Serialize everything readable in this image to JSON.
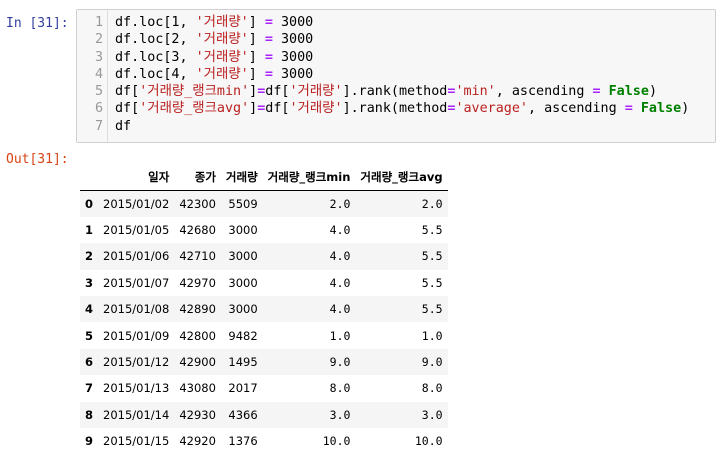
{
  "input_prompt": "In [31]:",
  "output_prompt": "Out[31]:",
  "code": [
    {
      "num": "1",
      "segments": [
        {
          "t": "df.loc[1, ",
          "c": ""
        },
        {
          "t": "'거래량'",
          "c": "t-str"
        },
        {
          "t": "] ",
          "c": ""
        },
        {
          "t": "=",
          "c": "t-op"
        },
        {
          "t": " 3000",
          "c": ""
        }
      ]
    },
    {
      "num": "2",
      "segments": [
        {
          "t": "df.loc[2, ",
          "c": ""
        },
        {
          "t": "'거래량'",
          "c": "t-str"
        },
        {
          "t": "] ",
          "c": ""
        },
        {
          "t": "=",
          "c": "t-op"
        },
        {
          "t": " 3000",
          "c": ""
        }
      ]
    },
    {
      "num": "3",
      "segments": [
        {
          "t": "df.loc[3, ",
          "c": ""
        },
        {
          "t": "'거래량'",
          "c": "t-str"
        },
        {
          "t": "] ",
          "c": ""
        },
        {
          "t": "=",
          "c": "t-op"
        },
        {
          "t": " 3000",
          "c": ""
        }
      ]
    },
    {
      "num": "4",
      "segments": [
        {
          "t": "df.loc[4, ",
          "c": ""
        },
        {
          "t": "'거래량'",
          "c": "t-str"
        },
        {
          "t": "] ",
          "c": ""
        },
        {
          "t": "=",
          "c": "t-op"
        },
        {
          "t": " 3000",
          "c": ""
        }
      ]
    },
    {
      "num": "5",
      "segments": [
        {
          "t": "df[",
          "c": ""
        },
        {
          "t": "'거래량_랭크min'",
          "c": "t-str"
        },
        {
          "t": "]",
          "c": ""
        },
        {
          "t": "=",
          "c": "t-op"
        },
        {
          "t": "df[",
          "c": ""
        },
        {
          "t": "'거래량'",
          "c": "t-str"
        },
        {
          "t": "].rank(method",
          "c": ""
        },
        {
          "t": "=",
          "c": "t-op"
        },
        {
          "t": "'min'",
          "c": "t-str"
        },
        {
          "t": ", ascending ",
          "c": ""
        },
        {
          "t": "=",
          "c": "t-op"
        },
        {
          "t": " ",
          "c": ""
        },
        {
          "t": "False",
          "c": "t-kw"
        },
        {
          "t": ")",
          "c": ""
        }
      ]
    },
    {
      "num": "6",
      "segments": [
        {
          "t": "df[",
          "c": ""
        },
        {
          "t": "'거래량_랭크avg'",
          "c": "t-str"
        },
        {
          "t": "]",
          "c": ""
        },
        {
          "t": "=",
          "c": "t-op"
        },
        {
          "t": "df[",
          "c": ""
        },
        {
          "t": "'거래량'",
          "c": "t-str"
        },
        {
          "t": "].rank(method",
          "c": ""
        },
        {
          "t": "=",
          "c": "t-op"
        },
        {
          "t": "'average'",
          "c": "t-str"
        },
        {
          "t": ", ascending ",
          "c": ""
        },
        {
          "t": "=",
          "c": "t-op"
        },
        {
          "t": " ",
          "c": ""
        },
        {
          "t": "False",
          "c": "t-kw"
        },
        {
          "t": ")",
          "c": ""
        }
      ]
    },
    {
      "num": "7",
      "segments": [
        {
          "t": "df",
          "c": ""
        }
      ]
    }
  ],
  "table": {
    "columns": [
      "",
      "일자",
      "종가",
      "거래량",
      "거래량_랭크min",
      "거래량_랭크avg"
    ],
    "rows": [
      [
        "0",
        "2015/01/02",
        "42300",
        "5509",
        "2.0",
        "2.0"
      ],
      [
        "1",
        "2015/01/05",
        "42680",
        "3000",
        "4.0",
        "5.5"
      ],
      [
        "2",
        "2015/01/06",
        "42710",
        "3000",
        "4.0",
        "5.5"
      ],
      [
        "3",
        "2015/01/07",
        "42970",
        "3000",
        "4.0",
        "5.5"
      ],
      [
        "4",
        "2015/01/08",
        "42890",
        "3000",
        "4.0",
        "5.5"
      ],
      [
        "5",
        "2015/01/09",
        "42800",
        "9482",
        "1.0",
        "1.0"
      ],
      [
        "6",
        "2015/01/12",
        "42900",
        "1495",
        "9.0",
        "9.0"
      ],
      [
        "7",
        "2015/01/13",
        "43080",
        "2017",
        "8.0",
        "8.0"
      ],
      [
        "8",
        "2015/01/14",
        "42930",
        "4366",
        "3.0",
        "3.0"
      ],
      [
        "9",
        "2015/01/15",
        "42920",
        "1376",
        "10.0",
        "10.0"
      ]
    ]
  }
}
